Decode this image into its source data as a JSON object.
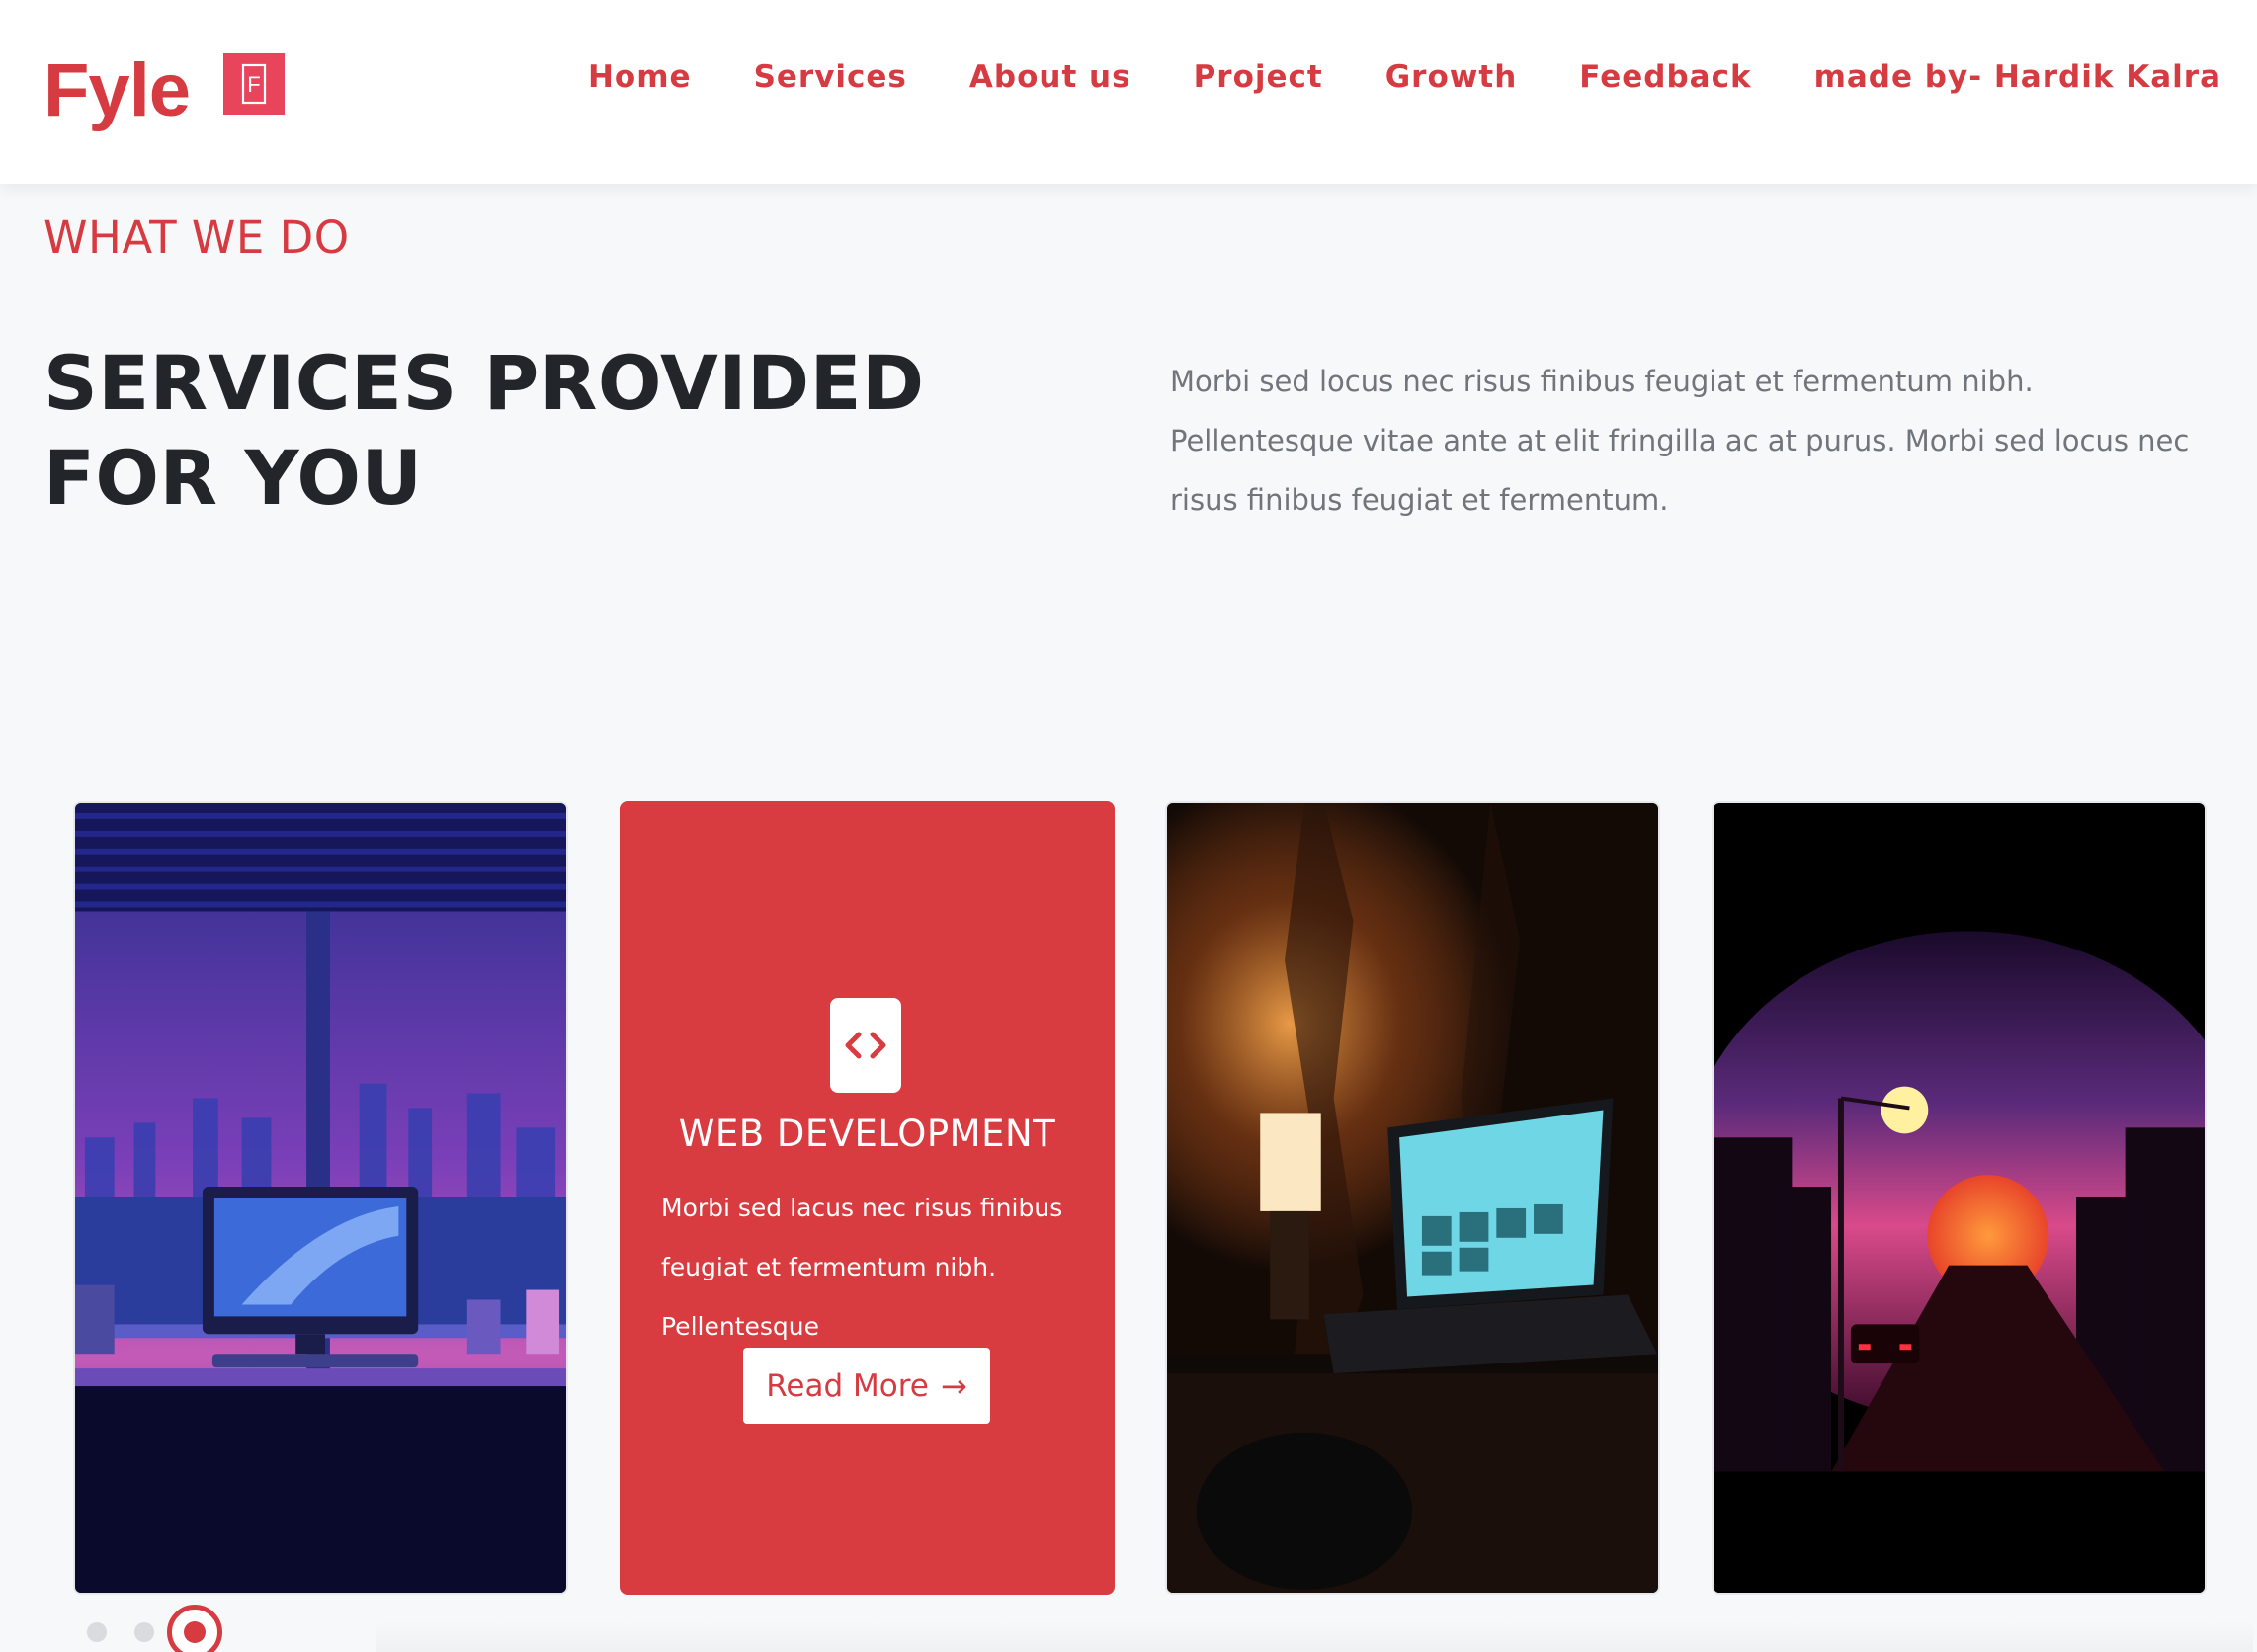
{
  "header": {
    "logo_text": "Fyle",
    "logo_badge_letter": "F",
    "nav": [
      "Home",
      "Services",
      "About us",
      "Project",
      "Growth",
      "Feedback",
      "made by- Hardik Kalra"
    ]
  },
  "section": {
    "eyebrow": "WHAT WE DO",
    "headline_line1": "SERVICES PROVIDED",
    "headline_line2": "FOR YOU",
    "intro": "Morbi sed locus nec risus finibus feugiat et fermentum nibh. Pellentesque vitae ante at elit fringilla ac at purus. Morbi sed locus nec risus finibus feugiat et fermentum."
  },
  "cards": [
    {
      "type": "image",
      "scene": "purple city window desk computer"
    },
    {
      "type": "service",
      "icon": "code-icon",
      "title": "WEB DEVELOPMENT",
      "text": "Morbi sed lacus nec risus finibus feugiat et fermentum nibh. Pellentesque",
      "button_label": "Read More",
      "button_icon": "arrow-right-icon"
    },
    {
      "type": "image",
      "scene": "laptop and lamp in dark room"
    },
    {
      "type": "image",
      "scene": "sunset highway city night"
    }
  ],
  "pagination": {
    "count": 3,
    "active": 3
  },
  "colors": {
    "accent": "#d63b42",
    "heading": "#22252a",
    "body_text": "#70757b",
    "background": "#f7f8fa",
    "card_red": "#d83c40"
  }
}
